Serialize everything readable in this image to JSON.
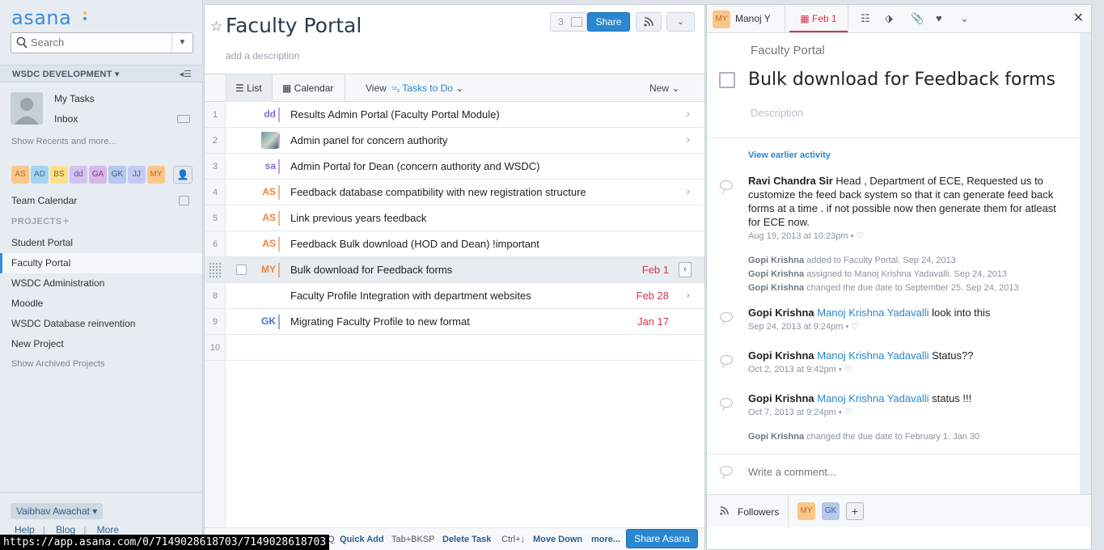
{
  "sidebar": {
    "logo": "asana",
    "search_placeholder": "Search",
    "workspace": "WSDC DEVELOPMENT",
    "my_tasks": "My Tasks",
    "inbox": "Inbox",
    "show_recents": "Show Recents and more...",
    "team_members": [
      {
        "initials": "AS",
        "bg": "#f9c78a",
        "fg": "#c26a1c"
      },
      {
        "initials": "AD",
        "bg": "#a6d5f2",
        "fg": "#2a6e9e"
      },
      {
        "initials": "BS",
        "bg": "#fbe08a",
        "fg": "#8a6a12"
      },
      {
        "initials": "dd",
        "bg": "#d3c3ee",
        "fg": "#6a4aa8"
      },
      {
        "initials": "GA",
        "bg": "#d7b8e6",
        "fg": "#7a3f96"
      },
      {
        "initials": "GK",
        "bg": "#b5c9ea",
        "fg": "#3e5f97"
      },
      {
        "initials": "JJ",
        "bg": "#c3cbf2",
        "fg": "#4a57a8"
      },
      {
        "initials": "MY",
        "bg": "#f9c78a",
        "fg": "#c26a1c"
      }
    ],
    "team_calendar": "Team Calendar",
    "projects_header": "PROJECTS",
    "projects": [
      "Student Portal",
      "Faculty Portal",
      "WSDC Administration",
      "Moodle",
      "WSDC Database reinvention",
      "New Project"
    ],
    "active_project": "Faculty Portal",
    "show_archived": "Show Archived Projects",
    "user_name": "Vaibhav Awachat",
    "footer_links": [
      "Help",
      "Blog",
      "More"
    ]
  },
  "project": {
    "title": "Faculty Portal",
    "add_description": "add a description",
    "member_count": "3",
    "share_label": "Share"
  },
  "viewbar": {
    "list": "List",
    "calendar": "Calendar",
    "view": "View",
    "filter": "Tasks to Do",
    "new": "New"
  },
  "tasks": [
    {
      "num": "1",
      "assignee": "dd",
      "color": "#8a6ad0",
      "name": "Results Admin Portal  (Faculty Portal Module)",
      "due": "",
      "chevron": true
    },
    {
      "num": "2",
      "assignee": "",
      "color": "#8a6ad0",
      "name": "Admin panel for concern authority",
      "due": "",
      "chevron": true
    },
    {
      "num": "3",
      "assignee": "sa",
      "color": "#8a6ad0",
      "name": "Admin Portal for Dean (concern authority and WSDC)",
      "due": "",
      "chevron": false
    },
    {
      "num": "4",
      "assignee": "AS",
      "color": "#e8843a",
      "name": "Feedback database compatibility with new registration structure",
      "due": "",
      "chevron": true
    },
    {
      "num": "5",
      "assignee": "AS",
      "color": "#e8843a",
      "name": "Link previous years feedback",
      "due": "",
      "chevron": false
    },
    {
      "num": "6",
      "assignee": "AS",
      "color": "#e8843a",
      "name": "Feedback Bulk download (HOD and Dean) !important",
      "due": "",
      "chevron": false
    },
    {
      "num": "",
      "assignee": "MY",
      "color": "#e8843a",
      "name": "Bulk download for Feedback forms",
      "due": "Feb 1",
      "chevron": false
    },
    {
      "num": "8",
      "assignee": "",
      "color": "",
      "name": "Faculty Profile Integration with department websites",
      "due": "Feb 28",
      "chevron": true
    },
    {
      "num": "9",
      "assignee": "GK",
      "color": "#4a72c0",
      "name": "Migrating Faculty Profile to new format",
      "due": "Jan 17",
      "chevron": false
    },
    {
      "num": "10",
      "assignee": "",
      "color": "",
      "name": "",
      "due": "",
      "chevron": false
    }
  ],
  "shortcuts": {
    "quick_add_key": "Tab+Q",
    "quick_add": "Quick Add",
    "delete_key": "Tab+BKSP",
    "delete": "Delete Task",
    "move_key": "Ctrl+↓",
    "move": "Move Down",
    "more": "more...",
    "share_asana": "Share Asana"
  },
  "details": {
    "assignee_initials": "MY",
    "assignee_name": "Manoj Y",
    "due": "Feb 1",
    "project": "Faculty Portal",
    "title": "Bulk download for Feedback forms",
    "description_placeholder": "Description",
    "view_earlier": "View earlier activity",
    "comments": [
      {
        "author": "Ravi Chandra Sir",
        "mention": "",
        "text": " Head , Department of ECE, Requested us to customize the feed back system so that it can generate feed back forms at a time .  if not possible now then generate them for atleast for ECE now.",
        "meta": "Aug 19, 2013 at 10:23pm  •  ♡"
      },
      {
        "author": "Gopi Krishna",
        "mention": "Manoj Krishna Yadavalli",
        "text": " look into this",
        "meta": "Sep 24, 2013 at 9:24pm  •  ♡"
      },
      {
        "author": "Gopi Krishna",
        "mention": "Manoj Krishna Yadavalli",
        "text": "  Status??",
        "meta": "Oct 2, 2013 at 9:42pm  •  ♡"
      },
      {
        "author": "Gopi Krishna",
        "mention": "Manoj Krishna Yadavalli",
        "text": " status !!!",
        "meta": "Oct 7, 2013 at 9:24pm  •  ♡"
      }
    ],
    "stories": [
      {
        "actor": "Gopi Krishna",
        "text": " added to Faculty Portal.   Sep 24, 2013"
      },
      {
        "actor": "Gopi Krishna",
        "text": " assigned to Manoj Krishna Yadavalli.   Sep 24, 2013"
      },
      {
        "actor": "Gopi Krishna",
        "text": " changed the due date to September 25.   Sep 24, 2013"
      },
      {
        "actor": "Gopi Krishna",
        "text": " changed the due date to February 1.   Jan 30"
      }
    ],
    "comment_placeholder": "Write a comment...",
    "followers_label": "Followers",
    "followers": [
      {
        "initials": "MY",
        "bg": "#f9c78a",
        "fg": "#c26a1c"
      },
      {
        "initials": "GK",
        "bg": "#b5c9ea",
        "fg": "#3e5f97"
      }
    ]
  },
  "status_url": "https://app.asana.com/0/7149028618703/7149028618703"
}
